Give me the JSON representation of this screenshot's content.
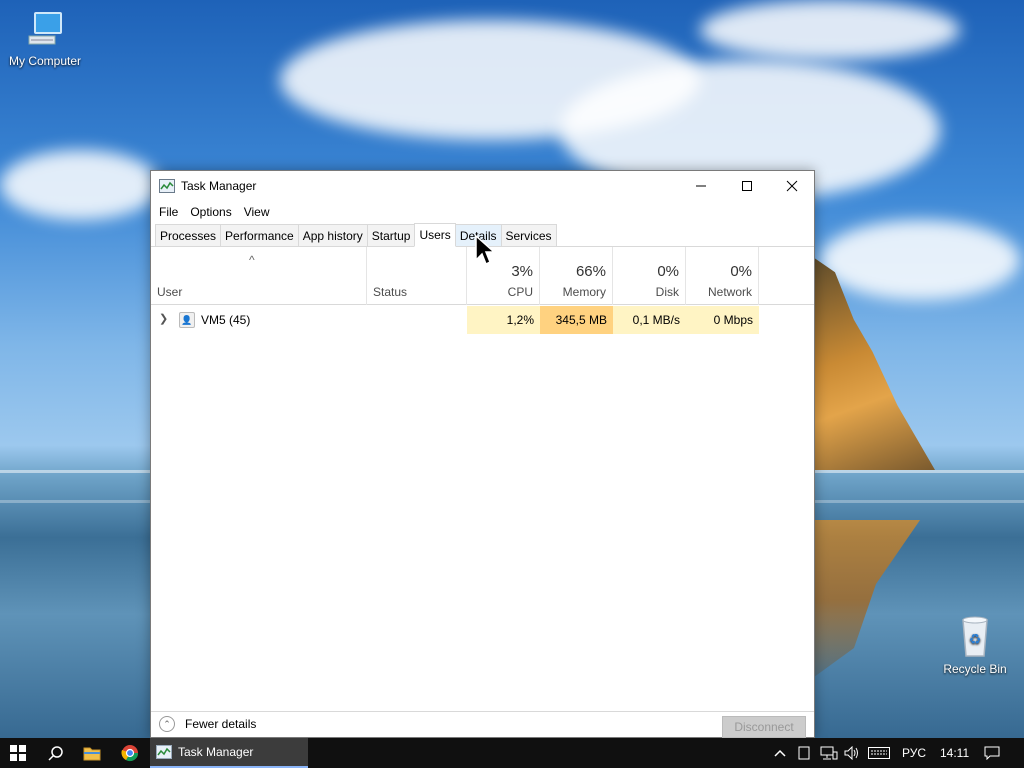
{
  "desktop": {
    "icons": [
      {
        "label": "My Computer"
      },
      {
        "label": "Recycle Bin"
      }
    ]
  },
  "window": {
    "title": "Task Manager",
    "menu": [
      "File",
      "Options",
      "View"
    ],
    "tabs": [
      "Processes",
      "Performance",
      "App history",
      "Startup",
      "Users",
      "Details",
      "Services"
    ],
    "active_tab": "Users",
    "columns": {
      "user": "User",
      "status": "Status",
      "cpu": {
        "pct": "3%",
        "label": "CPU"
      },
      "memory": {
        "pct": "66%",
        "label": "Memory"
      },
      "disk": {
        "pct": "0%",
        "label": "Disk"
      },
      "network": {
        "pct": "0%",
        "label": "Network"
      }
    },
    "rows": [
      {
        "user": "VM5 (45)",
        "status": "",
        "cpu": "1,2%",
        "memory": "345,5 MB",
        "disk": "0,1 MB/s",
        "network": "0 Mbps"
      }
    ],
    "footer": {
      "fewer_details": "Fewer details",
      "disconnect": "Disconnect"
    }
  },
  "taskbar": {
    "app_label": "Task Manager",
    "language": "РУС",
    "clock": "14:11"
  },
  "colors": {
    "heat_light": "#fff4c4",
    "heat_medium": "#ffd280",
    "taskbar_bg": "#101010"
  }
}
